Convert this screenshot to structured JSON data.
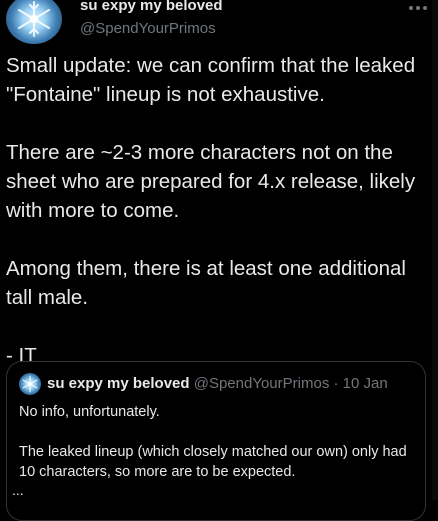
{
  "tweet": {
    "author": {
      "name": "su expy my beloved",
      "handle": "@SpendYourPrimos"
    },
    "paragraphs": [
      "Small update: we can confirm that the leaked \"Fontaine\" lineup is not exhaustive.",
      "There are ~2-3 more characters not on the sheet who are prepared for 4.x release, likely with more to come.",
      "Among them, there is at least one additional tall male.",
      "- IT"
    ]
  },
  "quoted_tweet": {
    "author": {
      "name": "su expy my beloved",
      "handle": "@SpendYourPrimos"
    },
    "separator": "·",
    "date": "10 Jan",
    "paragraphs": [
      "No info, unfortunately.",
      "The leaked lineup (which closely matched our own) only had 10 characters, so more are to be expected."
    ],
    "truncation": "..."
  },
  "icons": {
    "more": "more-horizontal-icon",
    "avatar": "snowflake-avatar"
  },
  "colors": {
    "background": "#000000",
    "text": "#e7e9ea",
    "secondary_text": "#71767b",
    "border": "#2f3336"
  }
}
